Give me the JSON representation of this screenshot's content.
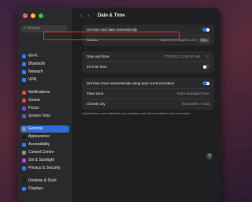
{
  "window": {
    "title": "Date & Time"
  },
  "toolbar": {
    "back_glyph": "‹",
    "forward_glyph": "›"
  },
  "sidebar": {
    "search_placeholder": "Search",
    "items": [
      {
        "label": "Wi-Fi",
        "icon": "wifi-icon",
        "color": "#2f7cf6"
      },
      {
        "label": "Bluetooth",
        "icon": "bluetooth-icon",
        "color": "#2f7cf6"
      },
      {
        "label": "Network",
        "icon": "network-icon",
        "color": "#2f7cf6"
      },
      {
        "label": "VPN",
        "icon": "vpn-icon",
        "color": "#2f7cf6"
      },
      {
        "label": "Notifications",
        "icon": "bell-icon",
        "color": "#e5483b"
      },
      {
        "label": "Sound",
        "icon": "speaker-icon",
        "color": "#e5483b"
      },
      {
        "label": "Focus",
        "icon": "moon-icon",
        "color": "#6b4fd8"
      },
      {
        "label": "Screen Time",
        "icon": "hourglass-icon",
        "color": "#6b4fd8"
      },
      {
        "label": "General",
        "icon": "gear-icon",
        "color": "#8e8e93",
        "selected": true
      },
      {
        "label": "Appearance",
        "icon": "appearance-icon",
        "color": "#1c1c1e"
      },
      {
        "label": "Accessibility",
        "icon": "accessibility-icon",
        "color": "#2f7cf6"
      },
      {
        "label": "Control Centre",
        "icon": "control-centre-icon",
        "color": "#8e8e93"
      },
      {
        "label": "Siri & Spotlight",
        "icon": "siri-icon",
        "color": "#b04bd8"
      },
      {
        "label": "Privacy & Security",
        "icon": "hand-icon",
        "color": "#2f7cf6"
      },
      {
        "label": "Desktop & Dock",
        "icon": "dock-icon",
        "color": "#1c1c1e"
      },
      {
        "label": "Displays",
        "icon": "display-icon",
        "color": "#2f7cf6"
      }
    ]
  },
  "section1": {
    "auto_label": "Set time and date automatically",
    "source_label": "Source",
    "source_value": "Apple (time.apple.com)",
    "set_button": "Set..."
  },
  "section2": {
    "date_label": "Date and time",
    "date_value": "27/10/23, 11:25:51 AM",
    "h24_label": "24-hour time"
  },
  "section3": {
    "tz_auto_label": "Set time zone automatically using your current location",
    "tz_label": "Time zone",
    "tz_value": "India Standard Time",
    "city_label": "Closest city",
    "city_value": "New Delhi - India"
  },
  "note": "Updated time zone definitions are available and will be installed at the next restart.",
  "help": "?"
}
